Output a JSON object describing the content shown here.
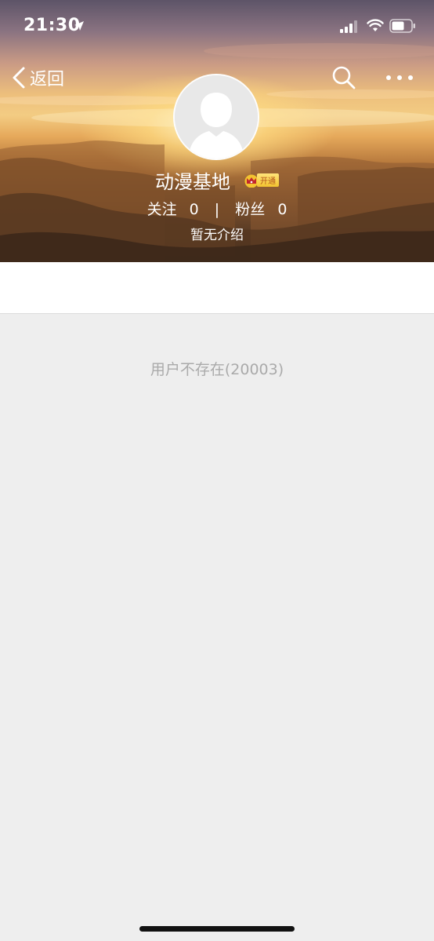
{
  "status_bar": {
    "time": "21:30"
  },
  "nav": {
    "back_label": "返回"
  },
  "profile": {
    "username": "动漫基地",
    "vip_label": "开通",
    "following_label": "关注",
    "following_count": "0",
    "divider": "|",
    "followers_label": "粉丝",
    "followers_count": "0",
    "intro": "暂无介绍"
  },
  "content": {
    "error_message": "用户不存在(20003)"
  },
  "colors": {
    "background": "#eeeeee",
    "error_text": "#aaaaaa",
    "vip_gold": "#f3c32f"
  }
}
